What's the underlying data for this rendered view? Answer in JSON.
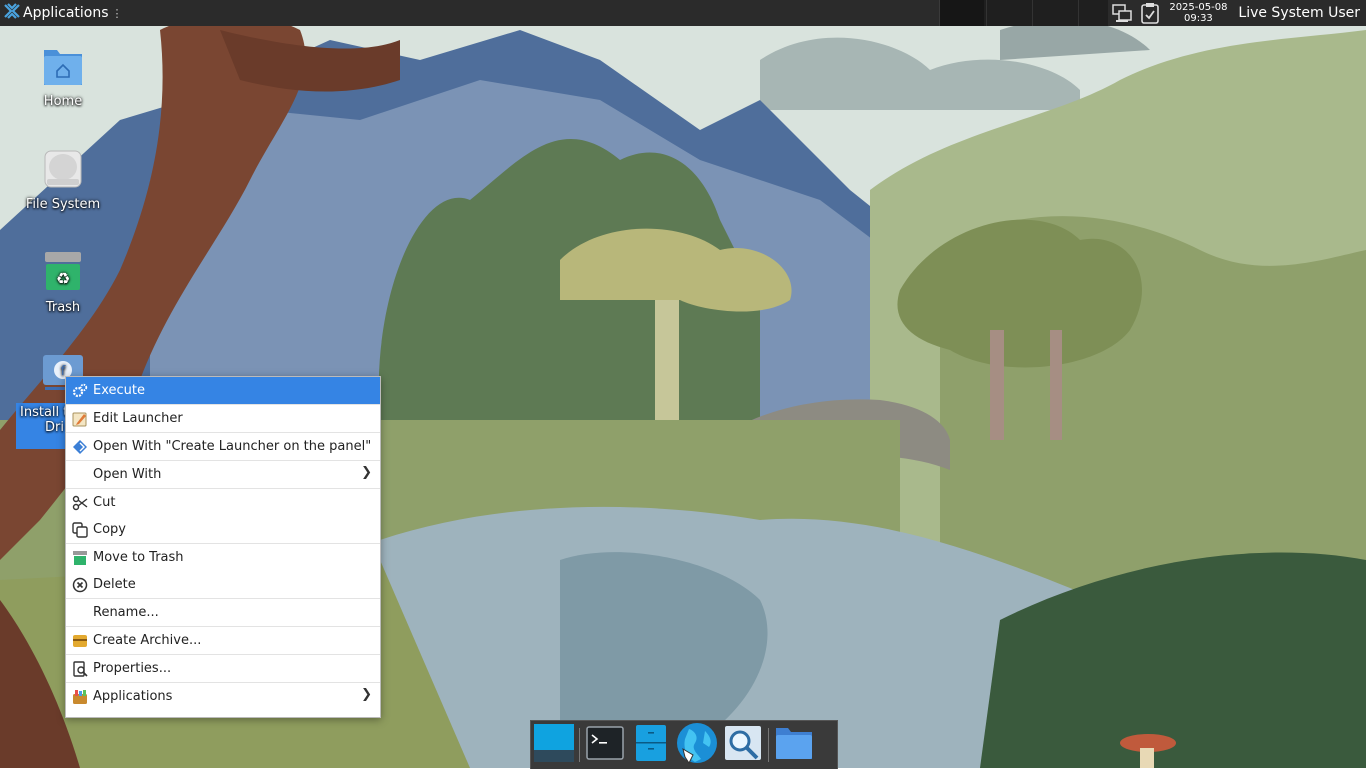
{
  "panel": {
    "apps_label": "Applications",
    "apps_grip": "⋮",
    "clock_date": "2025-05-08",
    "clock_time": "09:33",
    "user": "Live System User"
  },
  "desktop": {
    "icons": [
      {
        "label": "Home",
        "icon": "home-folder-icon"
      },
      {
        "label": "File System",
        "icon": "drive-icon"
      },
      {
        "label": "Trash",
        "icon": "trash-icon"
      },
      {
        "label_line1": "Install t",
        "label_line2": "Dri",
        "icon": "installer-icon"
      }
    ]
  },
  "context_menu": {
    "items": [
      {
        "label": "Execute",
        "icon": "gears-icon",
        "active": true
      },
      {
        "label": "Edit Launcher",
        "icon": "edit-icon"
      },
      {
        "label": "Open With \"Create Launcher on the panel\"",
        "icon": "launcher-icon"
      },
      {
        "label": "Open With",
        "submenu": true
      },
      {
        "label": "Cut",
        "icon": "scissors-icon"
      },
      {
        "label": "Copy",
        "icon": "copy-icon"
      },
      {
        "label": "Move to Trash",
        "icon": "trash-icon"
      },
      {
        "label": "Delete",
        "icon": "delete-icon"
      },
      {
        "label": "Rename..."
      },
      {
        "label": "Create Archive...",
        "icon": "archive-icon"
      },
      {
        "label": "Properties...",
        "icon": "properties-icon"
      },
      {
        "label": "Applications",
        "icon": "applications-icon",
        "submenu": true
      }
    ]
  },
  "dock": {
    "items": [
      "show-desktop-icon",
      "terminal-icon",
      "file-manager-icon",
      "web-browser-icon",
      "search-icon",
      "folder-icon"
    ]
  },
  "colors": {
    "panel_bg": "#2b2b2b",
    "accent": "#3584e4",
    "dock_bg": "#3a3a3a"
  }
}
